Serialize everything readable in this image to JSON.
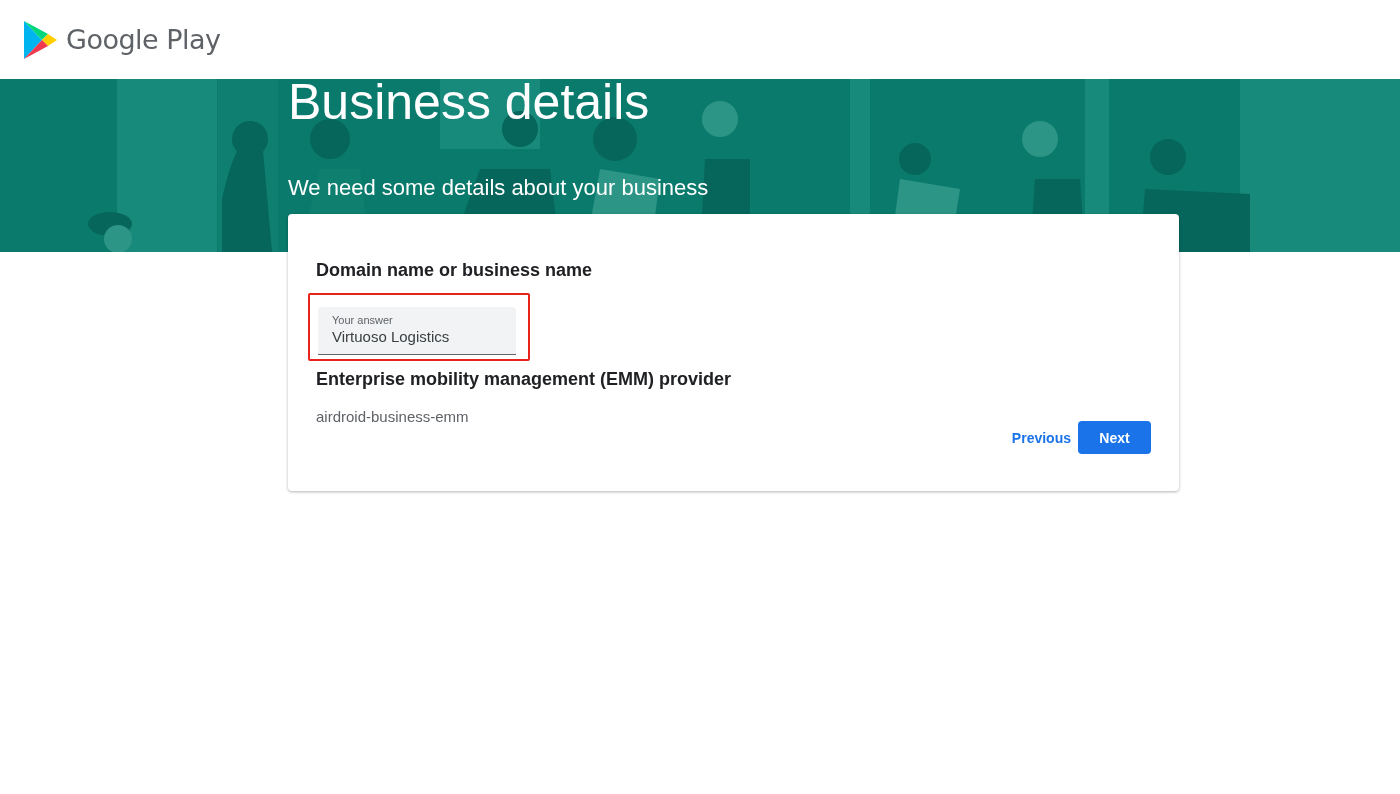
{
  "header": {
    "logo_text": "Google Play"
  },
  "banner": {
    "title": "Business details",
    "subtitle": "We need some details about your business"
  },
  "form": {
    "fields": [
      {
        "kind": "input",
        "label": "Domain name or business name",
        "placeholder": "Your answer",
        "value": "Virtuoso Logistics",
        "highlighted": true
      },
      {
        "kind": "static",
        "label": "Enterprise mobility management (EMM) provider",
        "value": "airdroid-business-emm"
      }
    ],
    "buttons": [
      {
        "kind": "text",
        "label": "Previous"
      },
      {
        "kind": "primary",
        "label": "Next"
      }
    ]
  }
}
